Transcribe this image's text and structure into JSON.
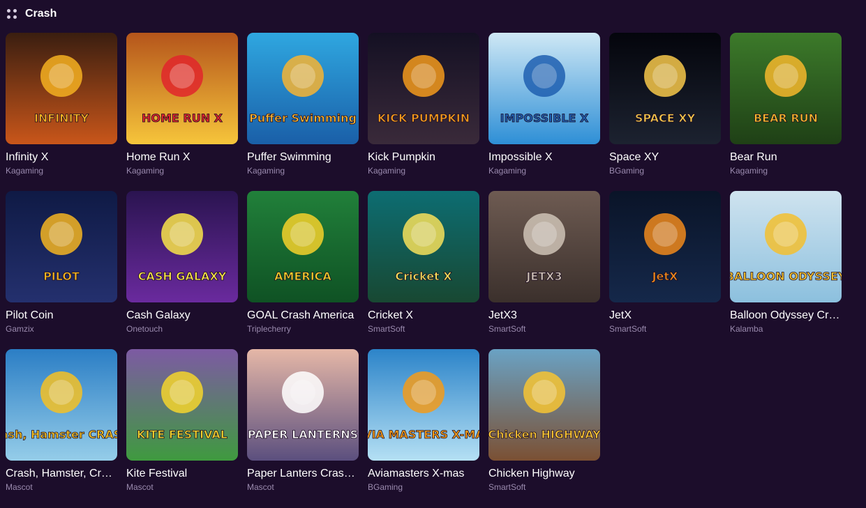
{
  "section": {
    "title": "Crash",
    "icon": "grid-dots-icon"
  },
  "games": [
    {
      "name": "Infinity X",
      "provider": "Kagaming",
      "logo": "INFINITY",
      "bg1": "#3a1e10",
      "bg2": "#c9561a",
      "accent": "#f5b021"
    },
    {
      "name": "Home Run X",
      "provider": "Kagaming",
      "logo": "HOME RUN X",
      "bg1": "#b5551b",
      "bg2": "#f6c53b",
      "accent": "#e0262c"
    },
    {
      "name": "Puffer Swimming",
      "provider": "Kagaming",
      "logo": "Puffer Swimming",
      "bg1": "#2fa7e0",
      "bg2": "#1a5fa8",
      "accent": "#f7b433"
    },
    {
      "name": "Kick Pumpkin",
      "provider": "Kagaming",
      "logo": "KICK PUMPKIN",
      "bg1": "#141023",
      "bg2": "#3a2a3a",
      "accent": "#f39a1c"
    },
    {
      "name": "Impossible X",
      "provider": "Kagaming",
      "logo": "IMPOSSIBLE X",
      "bg1": "#cfe8f5",
      "bg2": "#2e8fd6",
      "accent": "#1f5fb0"
    },
    {
      "name": "Space XY",
      "provider": "BGaming",
      "logo": "SPACE XY",
      "bg1": "#04050c",
      "bg2": "#1c2230",
      "accent": "#f7c84a"
    },
    {
      "name": "Bear Run",
      "provider": "Kagaming",
      "logo": "BEAR RUN",
      "bg1": "#3c7a2a",
      "bg2": "#1f4016",
      "accent": "#f6b72b"
    },
    {
      "name": "Pilot Coin",
      "provider": "Gamzix",
      "logo": "PILOT",
      "bg1": "#0f1a45",
      "bg2": "#24306e",
      "accent": "#f4b522"
    },
    {
      "name": "Cash Galaxy",
      "provider": "Onetouch",
      "logo": "CASH GALAXY",
      "bg1": "#2a1450",
      "bg2": "#6a2a9e",
      "accent": "#f9e44a"
    },
    {
      "name": "GOAL Crash America",
      "provider": "Triplecherry",
      "logo": "AMERICA",
      "bg1": "#21803a",
      "bg2": "#0f5224",
      "accent": "#f6d12a"
    },
    {
      "name": "Cricket X",
      "provider": "SmartSoft",
      "logo": "Cricket X",
      "bg1": "#0d6d72",
      "bg2": "#184832",
      "accent": "#f7e05a"
    },
    {
      "name": "JetX3",
      "provider": "SmartSoft",
      "logo": "JETX3",
      "bg1": "#6e5b52",
      "bg2": "#3b302c",
      "accent": "#cfc3b6"
    },
    {
      "name": "JetX",
      "provider": "SmartSoft",
      "logo": "JetX",
      "bg1": "#0a1428",
      "bg2": "#15284a",
      "accent": "#f08a1c"
    },
    {
      "name": "Balloon Odyssey Crash",
      "provider": "Kalamba",
      "logo": "BALLOON ODYSSEY",
      "bg1": "#cfe3ef",
      "bg2": "#8cc0de",
      "accent": "#f3c02f"
    },
    {
      "name": "Crash, Hamster, Crash!",
      "provider": "Mascot",
      "logo": "Crash, Hamster CRASH!",
      "bg1": "#2b7ec5",
      "bg2": "#95cde9",
      "accent": "#f4c125"
    },
    {
      "name": "Kite Festival",
      "provider": "Mascot",
      "logo": "KITE FESTIVAL",
      "bg1": "#7d5aa3",
      "bg2": "#3f9a3f",
      "accent": "#f4d52d"
    },
    {
      "name": "Paper Lanters Crash Game",
      "provider": "Mascot",
      "logo": "PAPER LANTERNS",
      "bg1": "#e5b7a7",
      "bg2": "#5b4f7e",
      "accent": "#ffffff"
    },
    {
      "name": "Aviamasters X-mas",
      "provider": "BGaming",
      "logo": "AVIA MASTERS X-MAS",
      "bg1": "#2c84c9",
      "bg2": "#b5e0f4",
      "accent": "#f39b1a"
    },
    {
      "name": "Chicken Highway",
      "provider": "SmartSoft",
      "logo": "Chicken HIGHWAY",
      "bg1": "#6aa2c4",
      "bg2": "#7b5033",
      "accent": "#f7c433"
    }
  ]
}
